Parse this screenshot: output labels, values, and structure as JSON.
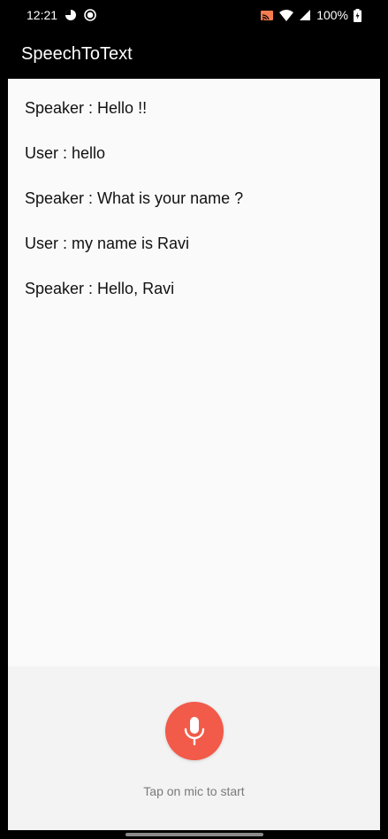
{
  "status_bar": {
    "time": "12:21",
    "battery": "100%",
    "icons": [
      "pie-timer-icon",
      "record-icon",
      "cast-icon",
      "wifi-icon",
      "signal-icon",
      "battery-icon"
    ]
  },
  "app_bar": {
    "title": "SpeechToText"
  },
  "conversation": [
    "Speaker : Hello !!",
    "User : hello",
    "Speaker : What is your name ?",
    "User : my name is Ravi",
    "Speaker : Hello, Ravi"
  ],
  "mic": {
    "hint": "Tap on mic to start",
    "color": "#f25a4a"
  }
}
